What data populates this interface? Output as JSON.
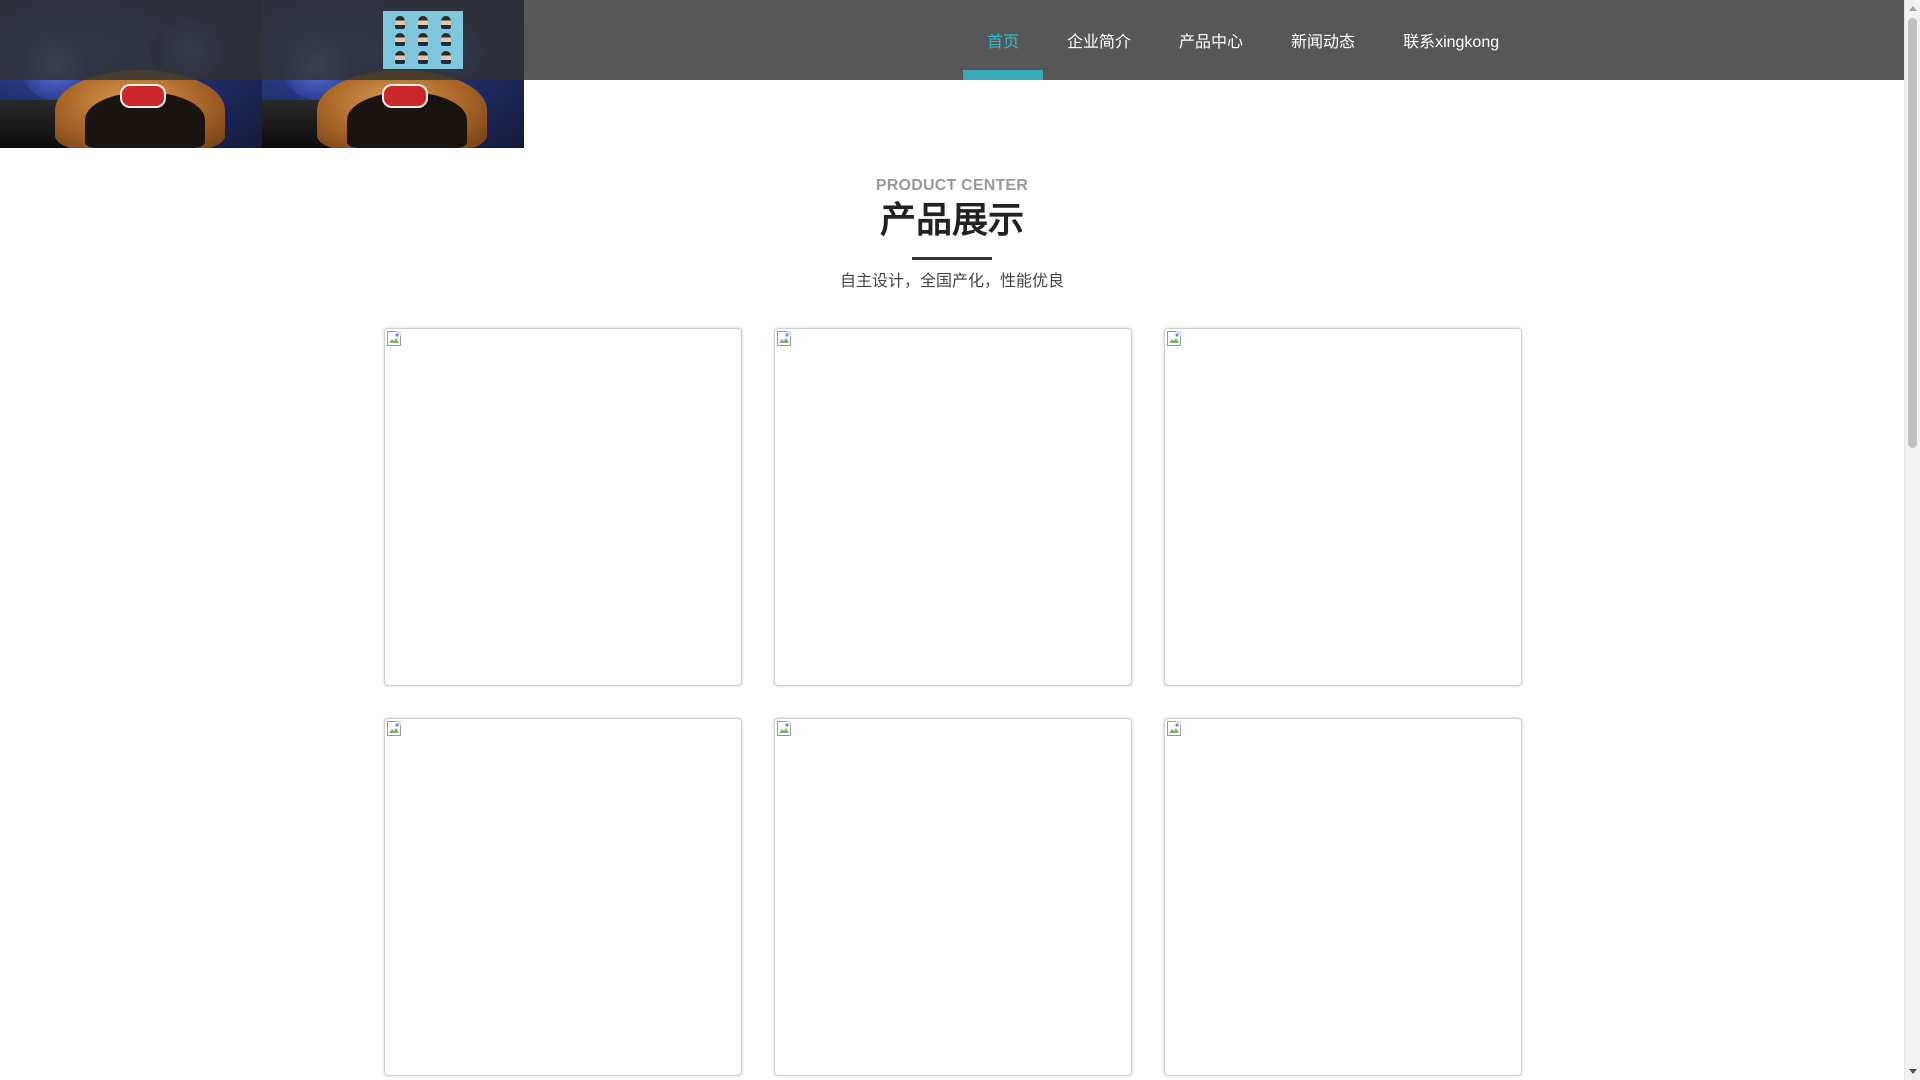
{
  "nav": {
    "logo_alt": "logo",
    "items": [
      {
        "label": "首页",
        "active": true
      },
      {
        "label": "企业简介",
        "active": false
      },
      {
        "label": "产品中心",
        "active": false
      },
      {
        "label": "新闻动态",
        "active": false
      },
      {
        "label": "联系xingkong",
        "active": false
      }
    ]
  },
  "section": {
    "subtitle_en": "PRODUCT CENTER",
    "title": "产品展示",
    "description": "自主设计，全国产化，性能优良"
  },
  "products": [
    {
      "image_state": "broken"
    },
    {
      "image_state": "broken"
    },
    {
      "image_state": "broken"
    },
    {
      "image_state": "broken"
    },
    {
      "image_state": "broken"
    },
    {
      "image_state": "broken"
    }
  ],
  "colors": {
    "accent": "#33b6c8",
    "nav_bg": "#323232",
    "title": "#222222"
  },
  "icons": {
    "broken_image": "broken-image-icon",
    "scroll_up": "arrow-up-icon",
    "scroll_down": "arrow-down-icon"
  }
}
